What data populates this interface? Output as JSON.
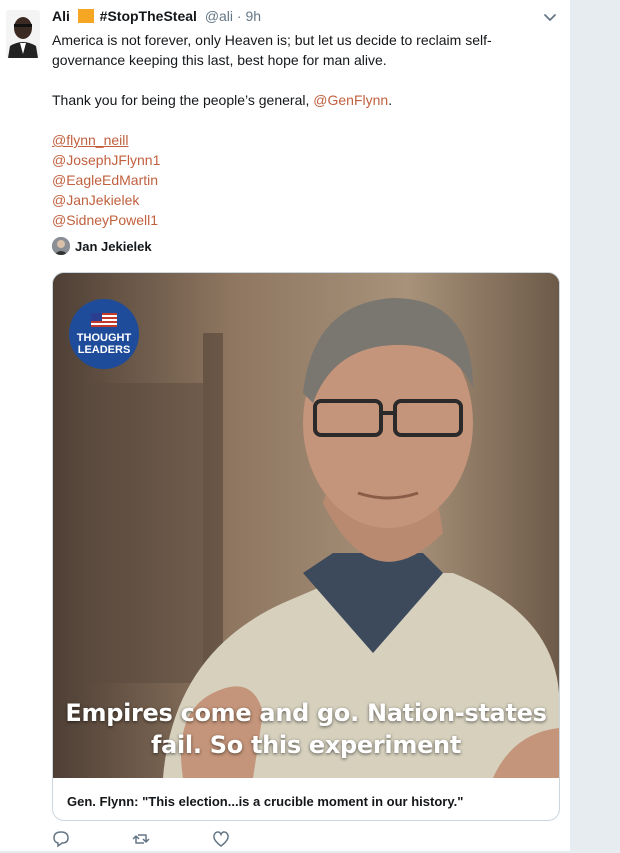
{
  "tweet": {
    "author": {
      "name": "Ali",
      "hashtag": "#StopTheSteal",
      "handle": "@ali",
      "time": "9h"
    },
    "body": {
      "line1": "America is not forever, only Heaven is; but let us decide to reclaim self-governance keeping this last, best hope for man alive.",
      "line2_prefix": "Thank you for being the people’s general, ",
      "line2_link": "@GenFlynn",
      "line2_suffix": ".",
      "mentions": [
        "@flynn_neill",
        "@JosephJFlynn1",
        "@EagleEdMartin",
        "@JanJekielek",
        "@SidneyPowell1"
      ]
    },
    "tagged_user": "Jan Jekielek",
    "video": {
      "badge_line1": "THOUGHT",
      "badge_line2": "LEADERS",
      "caption_line1": "Empires come and go. Nation-states",
      "caption_line2": "fail. So this experiment"
    },
    "card_title": "Gen. Flynn: \"This election...is a crucible moment in our history.\""
  },
  "colors": {
    "link": "#c1603e",
    "accent_flag": "#f5a623",
    "badge": "#1e4c9a",
    "background": "#e6ecf0"
  },
  "icons": [
    "reply-icon",
    "retweet-icon",
    "like-icon",
    "chevron-down-icon"
  ]
}
